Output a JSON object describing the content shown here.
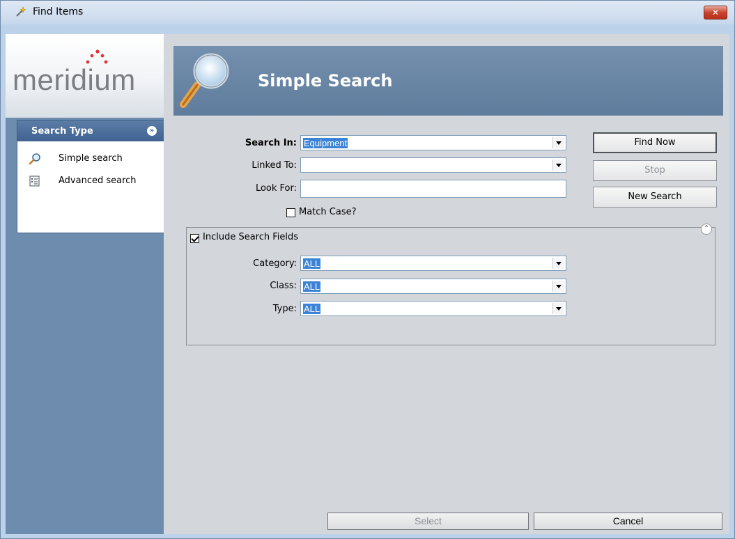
{
  "window": {
    "title": "Find Items",
    "close_label": "✕"
  },
  "logo": {
    "text": "meridium",
    "accent_color": "#e0363a"
  },
  "sidebar": {
    "title": "Search Type",
    "collapse_icon": "chevron-double-down-icon",
    "items": [
      {
        "label": "Simple search",
        "icon": "magnifier-icon"
      },
      {
        "label": "Advanced search",
        "icon": "list-form-icon"
      }
    ]
  },
  "header": {
    "title": "Simple Search",
    "icon": "magnifier-icon"
  },
  "form": {
    "search_in": {
      "label": "Search In:",
      "value": "Equipment"
    },
    "linked_to": {
      "label": "Linked To:",
      "value": ""
    },
    "look_for": {
      "label": "Look For:",
      "value": ""
    },
    "match_case": {
      "label": "Match Case?",
      "checked": false
    }
  },
  "buttons": {
    "find_now": "Find Now",
    "stop": "Stop",
    "new_search": "New Search"
  },
  "search_fields": {
    "label": "Include Search Fields",
    "checked": true,
    "category": {
      "label": "Category:",
      "value": "ALL"
    },
    "class": {
      "label": "Class:",
      "value": "ALL"
    },
    "type": {
      "label": "Type:",
      "value": "ALL"
    }
  },
  "footer": {
    "select": "Select",
    "cancel": "Cancel"
  },
  "colors": {
    "panel_blue": "#6d8cae",
    "banner_blue": "#6b87a6",
    "selection": "#3a83d6"
  }
}
